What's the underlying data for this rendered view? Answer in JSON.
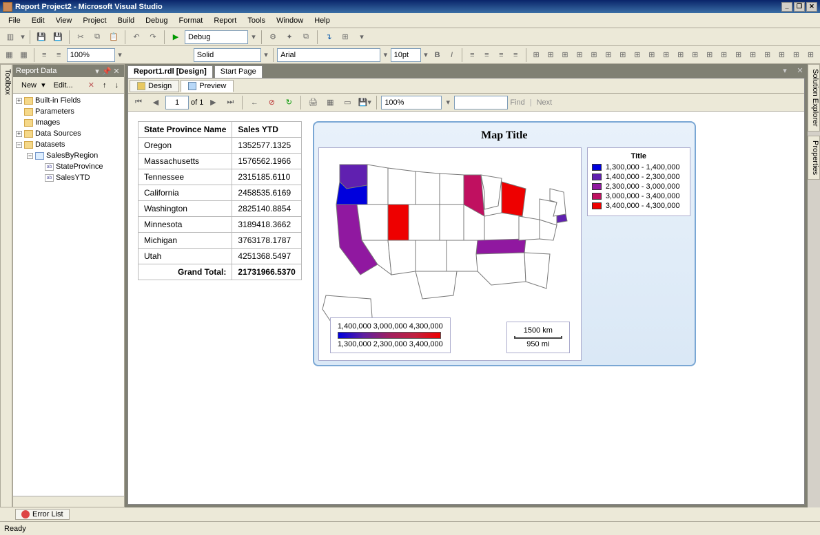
{
  "window": {
    "title": "Report Project2 - Microsoft Visual Studio"
  },
  "menu": [
    "File",
    "Edit",
    "View",
    "Project",
    "Build",
    "Debug",
    "Format",
    "Report",
    "Tools",
    "Window",
    "Help"
  ],
  "config_combo": "Debug",
  "format_toolbar": {
    "style": "Solid",
    "font": "Arial",
    "size": "10pt"
  },
  "report_data": {
    "title": "Report Data",
    "new_label": "New",
    "edit_label": "Edit...",
    "tree": {
      "builtin": "Built-in Fields",
      "params": "Parameters",
      "images": "Images",
      "sources": "Data Sources",
      "datasets": "Datasets",
      "dataset_name": "SalesByRegion",
      "field1": "StateProvince",
      "field2": "SalesYTD"
    }
  },
  "tabs": {
    "doc1": "Report1.rdl [Design]",
    "doc2": "Start Page"
  },
  "view_tabs": {
    "design": "Design",
    "preview": "Preview"
  },
  "preview_tb": {
    "page": "1",
    "of": "of",
    "total": "1",
    "zoom": "100%",
    "find": "Find",
    "next": "Next"
  },
  "chart_data": {
    "type": "table",
    "columns": [
      "State Province Name",
      "Sales YTD"
    ],
    "rows": [
      [
        "Oregon",
        "1352577.1325"
      ],
      [
        "Massachusetts",
        "1576562.1966"
      ],
      [
        "Tennessee",
        "2315185.6110"
      ],
      [
        "California",
        "2458535.6169"
      ],
      [
        "Washington",
        "2825140.8854"
      ],
      [
        "Minnesota",
        "3189418.3662"
      ],
      [
        "Michigan",
        "3763178.1787"
      ],
      [
        "Utah",
        "4251368.5497"
      ]
    ],
    "total_label": "Grand Total:",
    "total_value": "21731966.5370"
  },
  "map": {
    "title": "Map Title",
    "legend_title": "Title",
    "legend": [
      {
        "color": "#0000dd",
        "label": "1,300,000 - 1,400,000"
      },
      {
        "color": "#6020b0",
        "label": "1,400,000 - 2,300,000"
      },
      {
        "color": "#9018a0",
        "label": "2,300,000 - 3,000,000"
      },
      {
        "color": "#c01060",
        "label": "3,000,000 - 3,400,000"
      },
      {
        "color": "#ee0000",
        "label": "3,400,000 - 4,300,000"
      }
    ],
    "colorbar_top": "1,400,000  3,000,000  4,300,000",
    "colorbar_bottom": "1,300,000  2,300,000  3,400,000",
    "scale_km": "1500 km",
    "scale_mi": "950 mi",
    "state_colors": {
      "OR": "#0000dd",
      "WA": "#6020b0",
      "CA": "#9018a0",
      "UT": "#ee0000",
      "MN": "#c01060",
      "MI": "#ee0000",
      "TN": "#9018a0",
      "MA": "#6020b0"
    }
  },
  "side_panels": {
    "toolbox": "Toolbox",
    "solution": "Solution Explorer",
    "properties": "Properties"
  },
  "bottom_tab": "Error List",
  "status": "Ready",
  "zoom_main": "100%"
}
